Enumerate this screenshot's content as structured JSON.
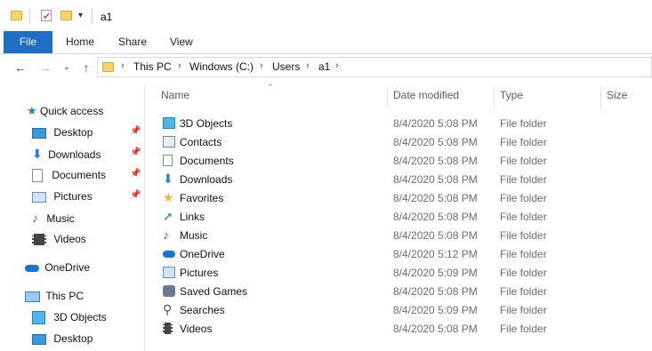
{
  "title": "a1",
  "ribbon": {
    "tabs": [
      "File",
      "Home",
      "Share",
      "View"
    ]
  },
  "address": {
    "crumbs": [
      "This PC",
      "Windows (C:)",
      "Users",
      "a1"
    ]
  },
  "nav": {
    "quick_access": "Quick access",
    "quick_items": [
      "Desktop",
      "Downloads",
      "Documents",
      "Pictures",
      "Music",
      "Videos"
    ],
    "onedrive": "OneDrive",
    "this_pc": "This PC",
    "pc_items": [
      "3D Objects",
      "Desktop"
    ]
  },
  "columns": {
    "name": "Name",
    "date": "Date modified",
    "type": "Type",
    "size": "Size"
  },
  "files": [
    {
      "name": "3D Objects",
      "date": "8/4/2020 5:08 PM",
      "type": "File folder",
      "icon": "3d-objects-icon"
    },
    {
      "name": "Contacts",
      "date": "8/4/2020 5:08 PM",
      "type": "File folder",
      "icon": "contacts-icon"
    },
    {
      "name": "Documents",
      "date": "8/4/2020 5:08 PM",
      "type": "File folder",
      "icon": "documents-icon"
    },
    {
      "name": "Downloads",
      "date": "8/4/2020 5:08 PM",
      "type": "File folder",
      "icon": "downloads-icon"
    },
    {
      "name": "Favorites",
      "date": "8/4/2020 5:08 PM",
      "type": "File folder",
      "icon": "favorites-icon"
    },
    {
      "name": "Links",
      "date": "8/4/2020 5:08 PM",
      "type": "File folder",
      "icon": "links-icon"
    },
    {
      "name": "Music",
      "date": "8/4/2020 5:08 PM",
      "type": "File folder",
      "icon": "music-icon"
    },
    {
      "name": "OneDrive",
      "date": "8/4/2020 5:12 PM",
      "type": "File folder",
      "icon": "onedrive-icon"
    },
    {
      "name": "Pictures",
      "date": "8/4/2020 5:09 PM",
      "type": "File folder",
      "icon": "pictures-icon"
    },
    {
      "name": "Saved Games",
      "date": "8/4/2020 5:08 PM",
      "type": "File folder",
      "icon": "saved-games-icon"
    },
    {
      "name": "Searches",
      "date": "8/4/2020 5:09 PM",
      "type": "File folder",
      "icon": "searches-icon"
    },
    {
      "name": "Videos",
      "date": "8/4/2020 5:08 PM",
      "type": "File folder",
      "icon": "videos-icon"
    }
  ],
  "colors": {
    "accent": "#1e6fc4",
    "folder": "#f8d56c",
    "header_text": "#4c607a"
  }
}
